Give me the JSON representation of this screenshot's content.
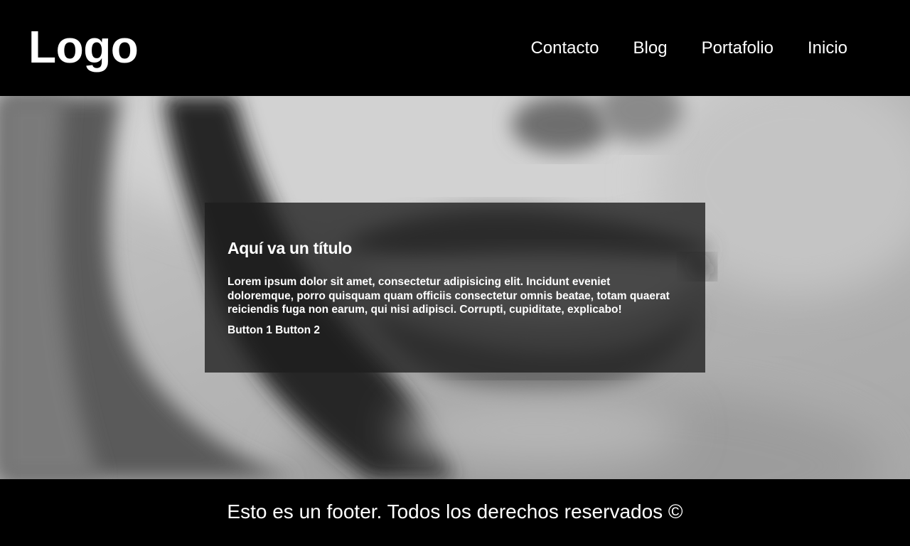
{
  "header": {
    "logo": "Logo",
    "nav": [
      {
        "label": "Contacto"
      },
      {
        "label": "Blog"
      },
      {
        "label": "Portafolio"
      },
      {
        "label": "Inicio"
      }
    ]
  },
  "hero": {
    "card": {
      "title": "Aquí va un título",
      "text": "Lorem ipsum dolor sit amet, consectetur adipisicing elit. Incidunt eveniet doloremque, porro quisquam quam officiis consectetur omnis beatae, totam quaerat reiciendis fuga non earum, qui nisi adipisci. Corrupti, cupiditate, explicabo!",
      "buttons": [
        {
          "label": "Button 1"
        },
        {
          "label": "Button 2"
        }
      ]
    }
  },
  "footer": {
    "text": "Esto es un footer. Todos los derechos reservados ©"
  }
}
